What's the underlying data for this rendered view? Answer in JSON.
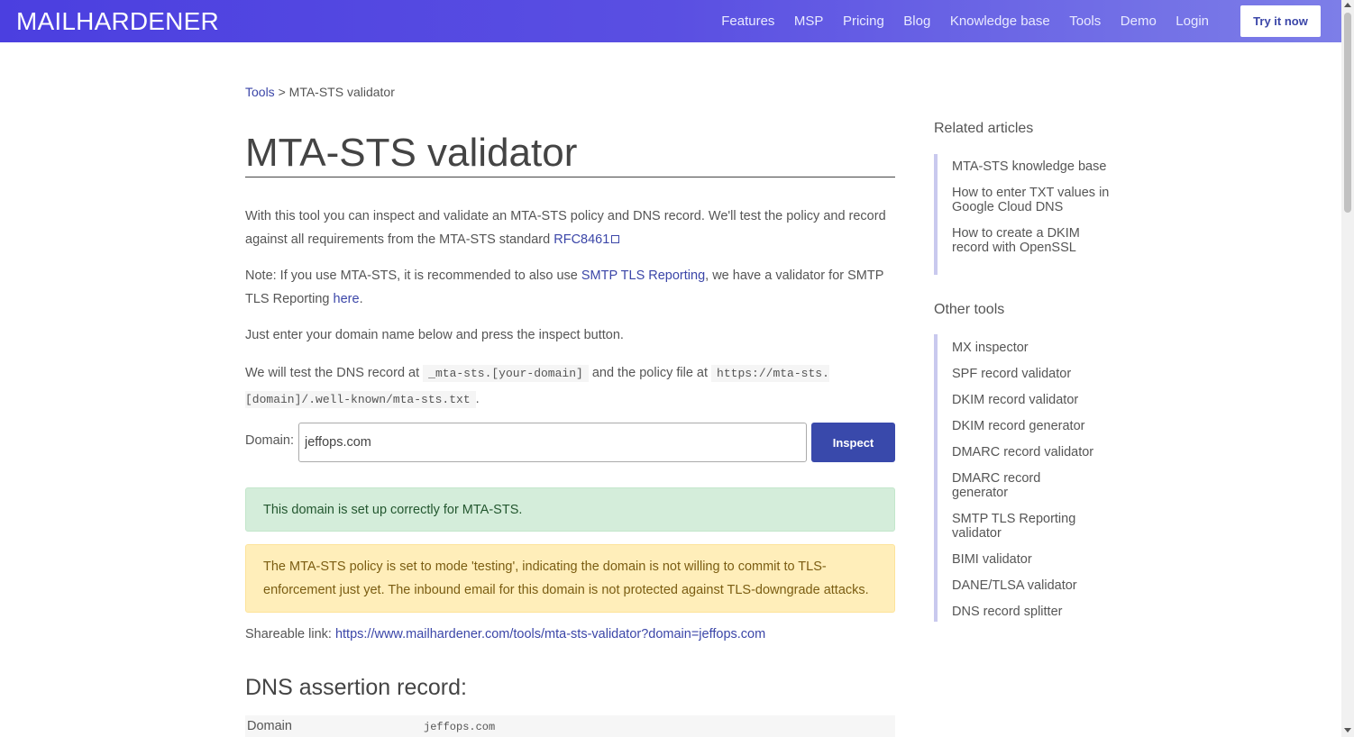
{
  "header": {
    "logo": "MAILHARDENER",
    "nav": [
      "Features",
      "MSP",
      "Pricing",
      "Blog",
      "Knowledge base",
      "Tools",
      "Demo",
      "Login"
    ],
    "cta": "Try it now"
  },
  "breadcrumb": {
    "parent": "Tools",
    "separator": " > ",
    "current": "MTA-STS validator"
  },
  "title": "MTA-STS validator",
  "intro": {
    "text": "With this tool you can inspect and validate an MTA-STS policy and DNS record. We'll test the policy and record against all requirements from the MTA-STS standard ",
    "link": "RFC8461"
  },
  "note": {
    "prefix": "Note: If you use MTA-STS, it is recommended to also use ",
    "link1": "SMTP TLS Reporting",
    "middle": ", we have a validator for SMTP TLS Reporting ",
    "link2": "here",
    "suffix": "."
  },
  "instruction": "Just enter your domain name below and press the inspect button.",
  "test_info": {
    "prefix": "We will test the DNS record at ",
    "code1": "_mta-sts.[your-domain]",
    "middle": " and the policy file at ",
    "code2": "https://mta-sts.[domain]/.well-known/mta-sts.txt",
    "suffix": "."
  },
  "form": {
    "label": "Domain:",
    "value": "jeffops.com",
    "button": "Inspect"
  },
  "alerts": {
    "success": "This domain is set up correctly for MTA-STS.",
    "warning": "The MTA-STS policy is set to mode 'testing', indicating the domain is not willing to commit to TLS-enforcement just yet. The inbound email for this domain is not protected against TLS-downgrade attacks."
  },
  "share": {
    "label": "Shareable link: ",
    "url": "https://www.mailhardener.com/tools/mta-sts-validator?domain=jeffops.com"
  },
  "dns_section": {
    "title": "DNS assertion record:",
    "row_key": "Domain",
    "row_value": "jeffops.com"
  },
  "sidebar": {
    "related_heading": "Related articles",
    "related": [
      "MTA-STS knowledge base",
      "How to enter TXT values in Google Cloud DNS",
      "How to create a DKIM record with OpenSSL"
    ],
    "tools_heading": "Other tools",
    "tools": [
      "MX inspector",
      "SPF record validator",
      "DKIM record validator",
      "DKIM record generator",
      "DMARC record validator",
      "DMARC record generator",
      "SMTP TLS Reporting validator",
      "BIMI validator",
      "DANE/TLSA validator",
      "DNS record splitter"
    ]
  },
  "colors": {
    "header_start": "#4b3fe0",
    "header_end": "#7d7ee8",
    "accent": "#3949ab",
    "link": "#3b46a8",
    "success_bg": "#d4edda",
    "warning_bg": "#ffeeba"
  }
}
